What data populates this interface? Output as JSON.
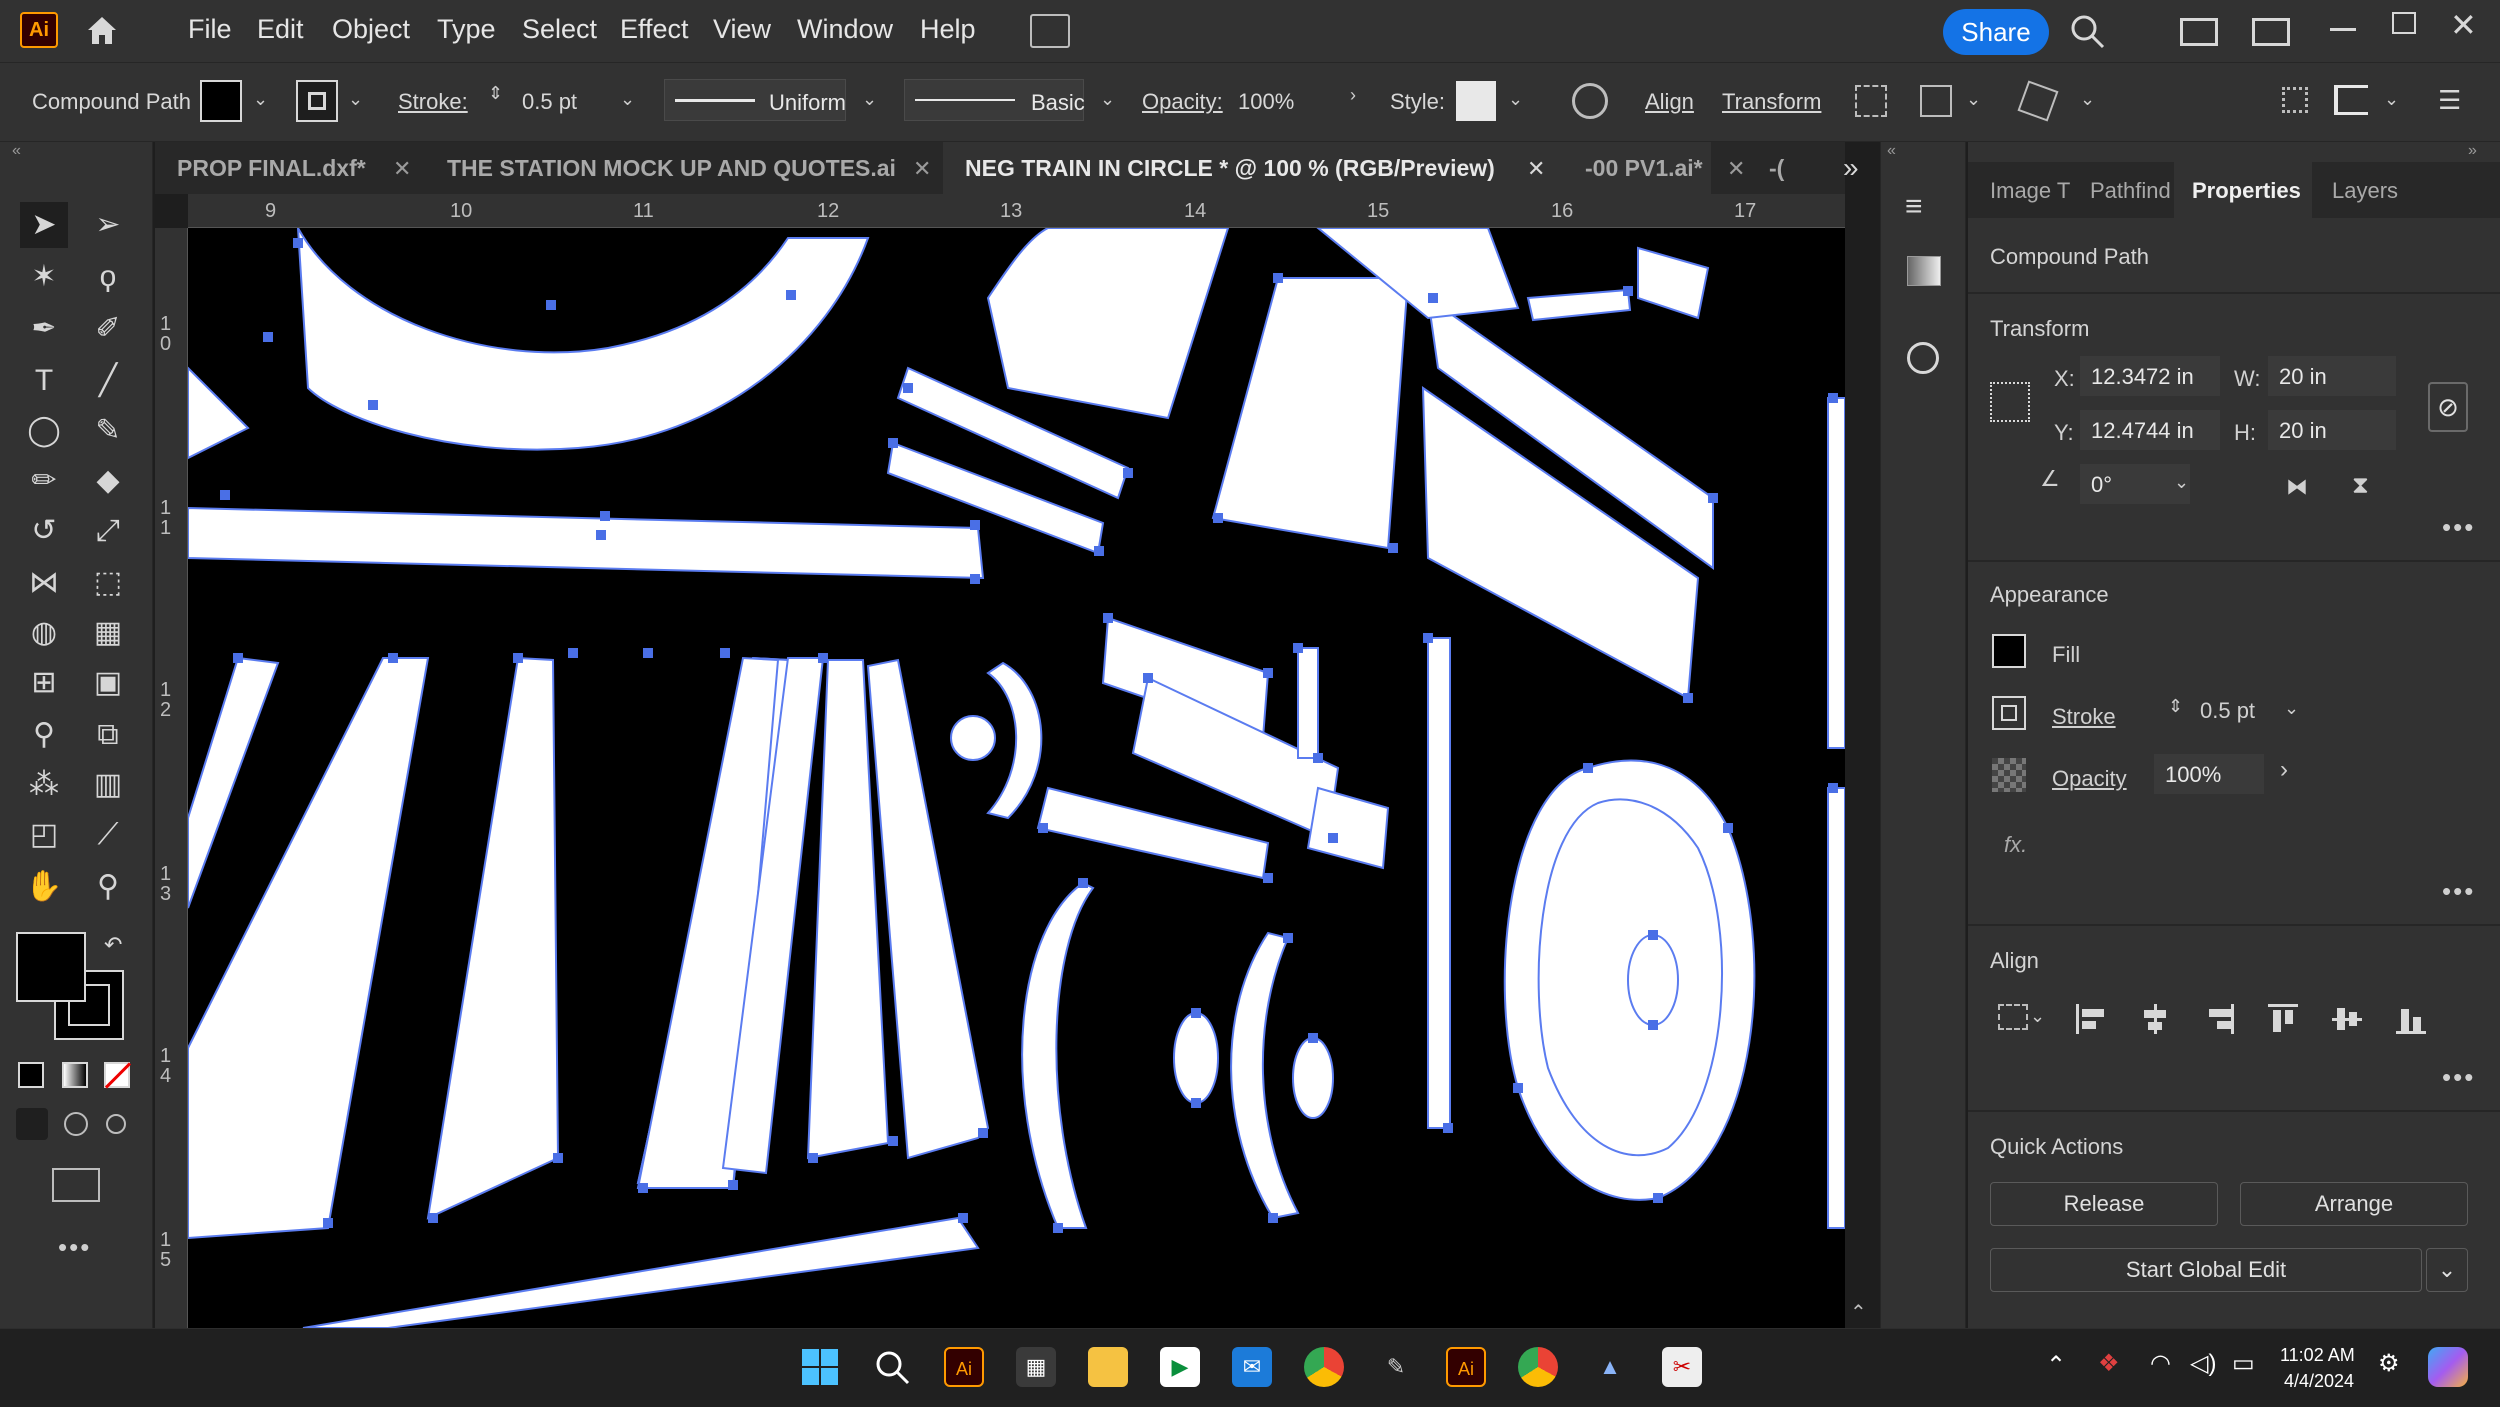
{
  "app": {
    "logo": "Ai"
  },
  "menu": [
    "File",
    "Edit",
    "Object",
    "Type",
    "Select",
    "Effect",
    "View",
    "Window",
    "Help"
  ],
  "share_label": "Share",
  "control": {
    "object_type": "Compound Path",
    "stroke_label": "Stroke:",
    "stroke_value": "0.5 pt",
    "profile": "Uniform",
    "brush": "Basic",
    "opacity_label": "Opacity:",
    "opacity_value": "100%",
    "style_label": "Style:",
    "align": "Align",
    "transform": "Transform"
  },
  "tabs": [
    {
      "label": "PROP FINAL.dxf*"
    },
    {
      "label": "THE STATION MOCK UP AND QUOTES.ai"
    },
    {
      "label": "NEG TRAIN IN CIRCLE * @ 100 % (RGB/Preview)"
    },
    {
      "label": "-00 PV1.ai*"
    },
    {
      "label": "-("
    }
  ],
  "ruler": {
    "top": [
      "9",
      "10",
      "11",
      "12",
      "13",
      "14",
      "15",
      "16",
      "17"
    ],
    "left": [
      "10",
      "11",
      "12",
      "13",
      "14",
      "15"
    ]
  },
  "panel_tabs": [
    "Image T",
    "Pathfind",
    "Properties",
    "Layers"
  ],
  "properties": {
    "title": "Compound Path",
    "transform_label": "Transform",
    "x_label": "X:",
    "x": "12.3472 in",
    "y_label": "Y:",
    "y": "12.4744 in",
    "w_label": "W:",
    "w": "20 in",
    "h_label": "H:",
    "h": "20 in",
    "angle": "0°",
    "appearance_label": "Appearance",
    "fill_label": "Fill",
    "stroke_label": "Stroke",
    "stroke_value": "0.5 pt",
    "opacity_label": "Opacity",
    "opacity_value": "100%",
    "fx": "fx.",
    "align_label": "Align",
    "quick_actions_label": "Quick Actions",
    "release": "Release",
    "arrange": "Arrange",
    "global_edit": "Start Global Edit"
  },
  "taskbar": {
    "time": "11:02 AM",
    "date": "4/4/2024"
  },
  "colors": {
    "accent": "#1473e6",
    "anchor": "#4a6fe6",
    "canvas": "#000000"
  }
}
